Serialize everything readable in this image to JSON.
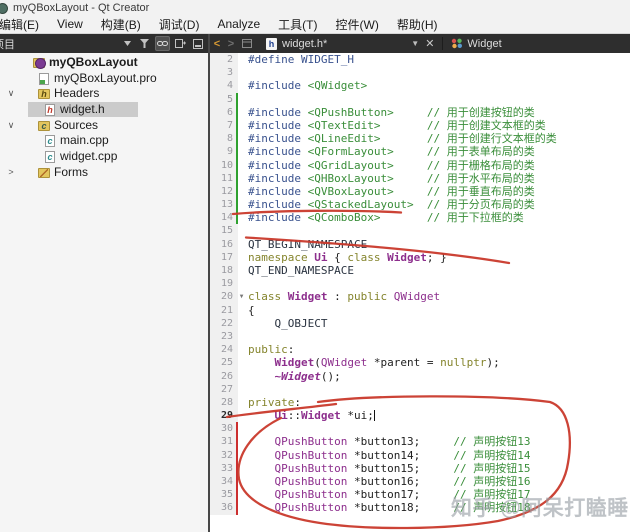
{
  "window": {
    "title": "myQBoxLayout - Qt Creator"
  },
  "menu_bar": {
    "items": [
      "编辑(E)",
      "View",
      "构建(B)",
      "调试(D)",
      "Analyze",
      "工具(T)",
      "控件(W)",
      "帮助(H)"
    ]
  },
  "project_panel": {
    "title": "项目",
    "tree": [
      {
        "label": "myQBoxLayout",
        "icon": "qt-project-icon",
        "iconX": 33,
        "bold": true
      },
      {
        "label": "myQBoxLayout.pro",
        "icon": "pro-file-icon",
        "iconX": 38
      },
      {
        "label": "Headers",
        "icon": "headers-folder-icon",
        "iconX": 38,
        "chevron": "expanded"
      },
      {
        "label": "widget.h",
        "icon": "header-file-icon",
        "iconX": 44,
        "selected": true
      },
      {
        "label": "Sources",
        "icon": "sources-folder-icon",
        "iconX": 38,
        "chevron": "expanded"
      },
      {
        "label": "main.cpp",
        "icon": "cpp-file-icon",
        "iconX": 44
      },
      {
        "label": "widget.cpp",
        "icon": "cpp-file-icon",
        "iconX": 44
      },
      {
        "label": "Forms",
        "icon": "forms-folder-icon",
        "iconX": 38,
        "chevron": "collapsed"
      }
    ]
  },
  "editor": {
    "tab": {
      "file_name": "widget.h*",
      "symbol": "Widget"
    },
    "lines": [
      {
        "n": 2,
        "seg": [
          [
            "pp",
            "#define WIDGET_H"
          ]
        ]
      },
      {
        "n": 3,
        "seg": []
      },
      {
        "n": 4,
        "seg": [
          [
            "pp",
            "#include "
          ],
          [
            "inc",
            "<QWidget>"
          ]
        ]
      },
      {
        "n": 5,
        "bar": "g",
        "seg": []
      },
      {
        "n": 6,
        "bar": "g",
        "seg": [
          [
            "pp",
            "#include "
          ],
          [
            "inc",
            "<QPushButton>"
          ],
          [
            "txt",
            "     "
          ],
          [
            "com",
            "// 用于创建按钮的类"
          ]
        ]
      },
      {
        "n": 7,
        "bar": "g",
        "seg": [
          [
            "pp",
            "#include "
          ],
          [
            "inc",
            "<QTextEdit>"
          ],
          [
            "txt",
            "       "
          ],
          [
            "com",
            "// 用于创建文本框的类"
          ]
        ]
      },
      {
        "n": 8,
        "bar": "g",
        "seg": [
          [
            "pp",
            "#include "
          ],
          [
            "inc",
            "<QLineEdit>"
          ],
          [
            "txt",
            "       "
          ],
          [
            "com",
            "// 用于创建行文本框的类"
          ]
        ]
      },
      {
        "n": 9,
        "bar": "g",
        "seg": [
          [
            "pp",
            "#include "
          ],
          [
            "inc",
            "<QFormLayout>"
          ],
          [
            "txt",
            "     "
          ],
          [
            "com",
            "// 用于表单布局的类"
          ]
        ]
      },
      {
        "n": 10,
        "bar": "g",
        "seg": [
          [
            "pp",
            "#include "
          ],
          [
            "inc",
            "<QGridLayout>"
          ],
          [
            "txt",
            "     "
          ],
          [
            "com",
            "// 用于栅格布局的类"
          ]
        ]
      },
      {
        "n": 11,
        "bar": "g",
        "seg": [
          [
            "pp",
            "#include "
          ],
          [
            "inc",
            "<QHBoxLayout>"
          ],
          [
            "txt",
            "     "
          ],
          [
            "com",
            "// 用于水平布局的类"
          ]
        ]
      },
      {
        "n": 12,
        "bar": "g",
        "seg": [
          [
            "pp",
            "#include "
          ],
          [
            "inc",
            "<QVBoxLayout>"
          ],
          [
            "txt",
            "     "
          ],
          [
            "com",
            "// 用于垂直布局的类"
          ]
        ]
      },
      {
        "n": 13,
        "bar": "g",
        "seg": [
          [
            "pp",
            "#include "
          ],
          [
            "inc",
            "<QStackedLayout>"
          ],
          [
            "txt",
            "  "
          ],
          [
            "com",
            "// 用于分页布局的类"
          ]
        ]
      },
      {
        "n": 14,
        "bar": "g",
        "seg": [
          [
            "pp",
            "#include "
          ],
          [
            "inc",
            "<QComboBox>"
          ],
          [
            "txt",
            "       "
          ],
          [
            "com",
            "// 用于下拉框的类"
          ]
        ]
      },
      {
        "n": 15,
        "seg": []
      },
      {
        "n": 16,
        "seg": [
          [
            "macro",
            "QT_BEGIN_NAMESPACE"
          ]
        ]
      },
      {
        "n": 17,
        "seg": [
          [
            "kw",
            "namespace "
          ],
          [
            "typeb",
            "Ui"
          ],
          [
            "txt",
            " { "
          ],
          [
            "kw",
            "class "
          ],
          [
            "typeb",
            "Widget"
          ],
          [
            "txt",
            "; }"
          ]
        ]
      },
      {
        "n": 18,
        "seg": [
          [
            "macro",
            "QT_END_NAMESPACE"
          ]
        ]
      },
      {
        "n": 19,
        "seg": []
      },
      {
        "n": 20,
        "fold": true,
        "seg": [
          [
            "kw",
            "class "
          ],
          [
            "typeb",
            "Widget"
          ],
          [
            "txt",
            " : "
          ],
          [
            "kw",
            "public "
          ],
          [
            "type",
            "QWidget"
          ]
        ]
      },
      {
        "n": 21,
        "seg": [
          [
            "txt",
            "{"
          ]
        ]
      },
      {
        "n": 22,
        "seg": [
          [
            "txt",
            "    "
          ],
          [
            "macro",
            "Q_OBJECT"
          ]
        ]
      },
      {
        "n": 23,
        "seg": []
      },
      {
        "n": 24,
        "seg": [
          [
            "kw",
            "public"
          ],
          [
            "txt",
            ":"
          ]
        ]
      },
      {
        "n": 25,
        "seg": [
          [
            "txt",
            "    "
          ],
          [
            "typeb",
            "Widget"
          ],
          [
            "txt",
            "("
          ],
          [
            "type",
            "QWidget"
          ],
          [
            "txt",
            " *parent = "
          ],
          [
            "kw",
            "nullptr"
          ],
          [
            "txt",
            ");"
          ]
        ]
      },
      {
        "n": 26,
        "seg": [
          [
            "txt",
            "    "
          ],
          [
            "typebi",
            "~Widget"
          ],
          [
            "txt",
            "();"
          ]
        ]
      },
      {
        "n": 27,
        "seg": []
      },
      {
        "n": 28,
        "seg": [
          [
            "kw",
            "private"
          ],
          [
            "txt",
            ":"
          ]
        ]
      },
      {
        "n": 29,
        "current": true,
        "caret": true,
        "seg": [
          [
            "txt",
            "    "
          ],
          [
            "typeb",
            "Ui"
          ],
          [
            "txt",
            "::"
          ],
          [
            "typeb",
            "Widget"
          ],
          [
            "txt",
            " *ui;"
          ]
        ]
      },
      {
        "n": 30,
        "bar": "r",
        "seg": []
      },
      {
        "n": 31,
        "bar": "r",
        "seg": [
          [
            "txt",
            "    "
          ],
          [
            "type",
            "QPushButton"
          ],
          [
            "txt",
            " *button13;     "
          ],
          [
            "com",
            "// 声明按钮13"
          ]
        ]
      },
      {
        "n": 32,
        "bar": "r",
        "seg": [
          [
            "txt",
            "    "
          ],
          [
            "type",
            "QPushButton"
          ],
          [
            "txt",
            " *button14;     "
          ],
          [
            "com",
            "// 声明按钮14"
          ]
        ]
      },
      {
        "n": 33,
        "bar": "r",
        "seg": [
          [
            "txt",
            "    "
          ],
          [
            "type",
            "QPushButton"
          ],
          [
            "txt",
            " *button15;     "
          ],
          [
            "com",
            "// 声明按钮15"
          ]
        ]
      },
      {
        "n": 34,
        "bar": "r",
        "seg": [
          [
            "txt",
            "    "
          ],
          [
            "type",
            "QPushButton"
          ],
          [
            "txt",
            " *button16;     "
          ],
          [
            "com",
            "// 声明按钮16"
          ]
        ]
      },
      {
        "n": 35,
        "bar": "r",
        "seg": [
          [
            "txt",
            "    "
          ],
          [
            "type",
            "QPushButton"
          ],
          [
            "txt",
            " *button17;     "
          ],
          [
            "com",
            "// 声明按钮17"
          ]
        ]
      },
      {
        "n": 36,
        "bar": "r",
        "seg": [
          [
            "txt",
            "    "
          ],
          [
            "type",
            "QPushButton"
          ],
          [
            "txt",
            " *button18;     "
          ],
          [
            "com",
            "// 声明按钮18"
          ]
        ]
      }
    ]
  },
  "watermark": {
    "text": "知乎 @阿呆打瞌睡"
  },
  "colors": {
    "annotation_ink": "#c9392b",
    "change_bar_added": "#2fa12f",
    "change_bar_modified": "#cc2f2f",
    "tree_selection": "#cbcbcb",
    "dark_toolbar": "#2e2e2e"
  }
}
